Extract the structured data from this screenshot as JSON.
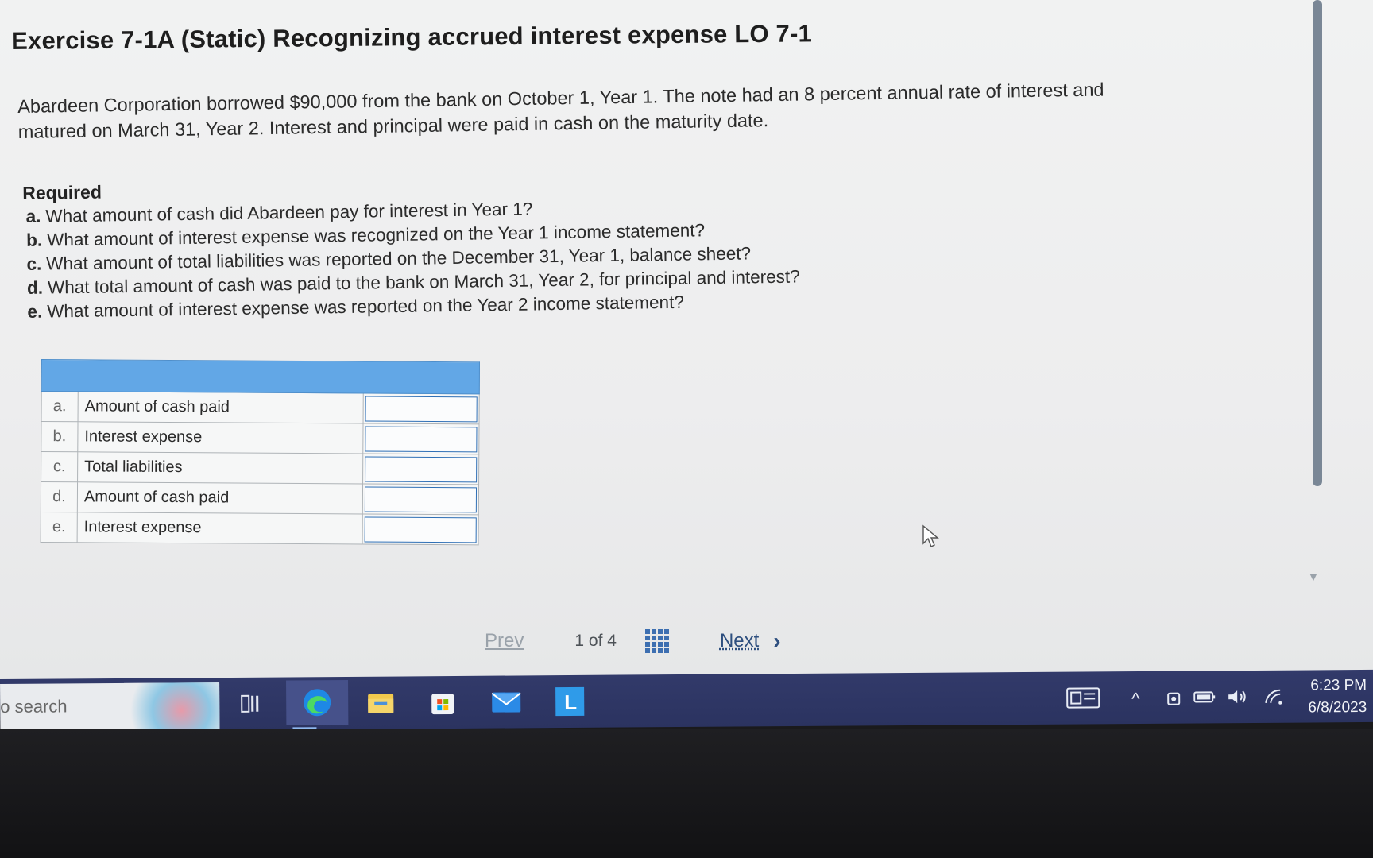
{
  "exercise": {
    "title": "Exercise 7-1A (Static) Recognizing accrued interest expense LO 7-1",
    "problem_line1": "Abardeen Corporation borrowed $90,000 from the bank on October 1, Year 1. The note had an 8 percent annual rate of interest and",
    "problem_line2": "matured on March 31, Year 2. Interest and principal were paid in cash on the maturity date."
  },
  "required": {
    "heading": "Required",
    "items": [
      {
        "letter": "a.",
        "text": "What amount of cash did Abardeen pay for interest in Year 1?"
      },
      {
        "letter": "b.",
        "text": "What amount of interest expense was recognized on the Year 1 income statement?"
      },
      {
        "letter": "c.",
        "text": "What amount of total liabilities was reported on the December 31, Year 1, balance sheet?"
      },
      {
        "letter": "d.",
        "text": "What total amount of cash was paid to the bank on March 31, Year 2, for principal and interest?"
      },
      {
        "letter": "e.",
        "text": "What amount of interest expense was reported on the Year 2 income statement?"
      }
    ]
  },
  "answer_table": {
    "rows": [
      {
        "letter": "a.",
        "label": "Amount of cash paid",
        "value": ""
      },
      {
        "letter": "b.",
        "label": "Interest expense",
        "value": ""
      },
      {
        "letter": "c.",
        "label": "Total liabilities",
        "value": ""
      },
      {
        "letter": "d.",
        "label": "Amount of cash paid",
        "value": ""
      },
      {
        "letter": "e.",
        "label": "Interest expense",
        "value": ""
      }
    ]
  },
  "pagination": {
    "prev_label": "Prev",
    "current": "1",
    "of_label": "of",
    "total": "4",
    "next_label": "Next"
  },
  "taskbar": {
    "search_placeholder": "o search",
    "time": "6:23 PM",
    "date": "6/8/2023",
    "colors": {
      "bar": "#2b3360",
      "accent": "#1e88e5"
    }
  },
  "icons": [
    "task-view-icon",
    "edge-browser-icon",
    "file-explorer-icon",
    "microsoft-store-icon",
    "mail-icon",
    "app-l-icon",
    "news-widget-icon",
    "chevron-up-icon",
    "meet-now-icon",
    "battery-icon",
    "speaker-icon",
    "wifi-icon",
    "grid-icon",
    "cursor-icon"
  ]
}
